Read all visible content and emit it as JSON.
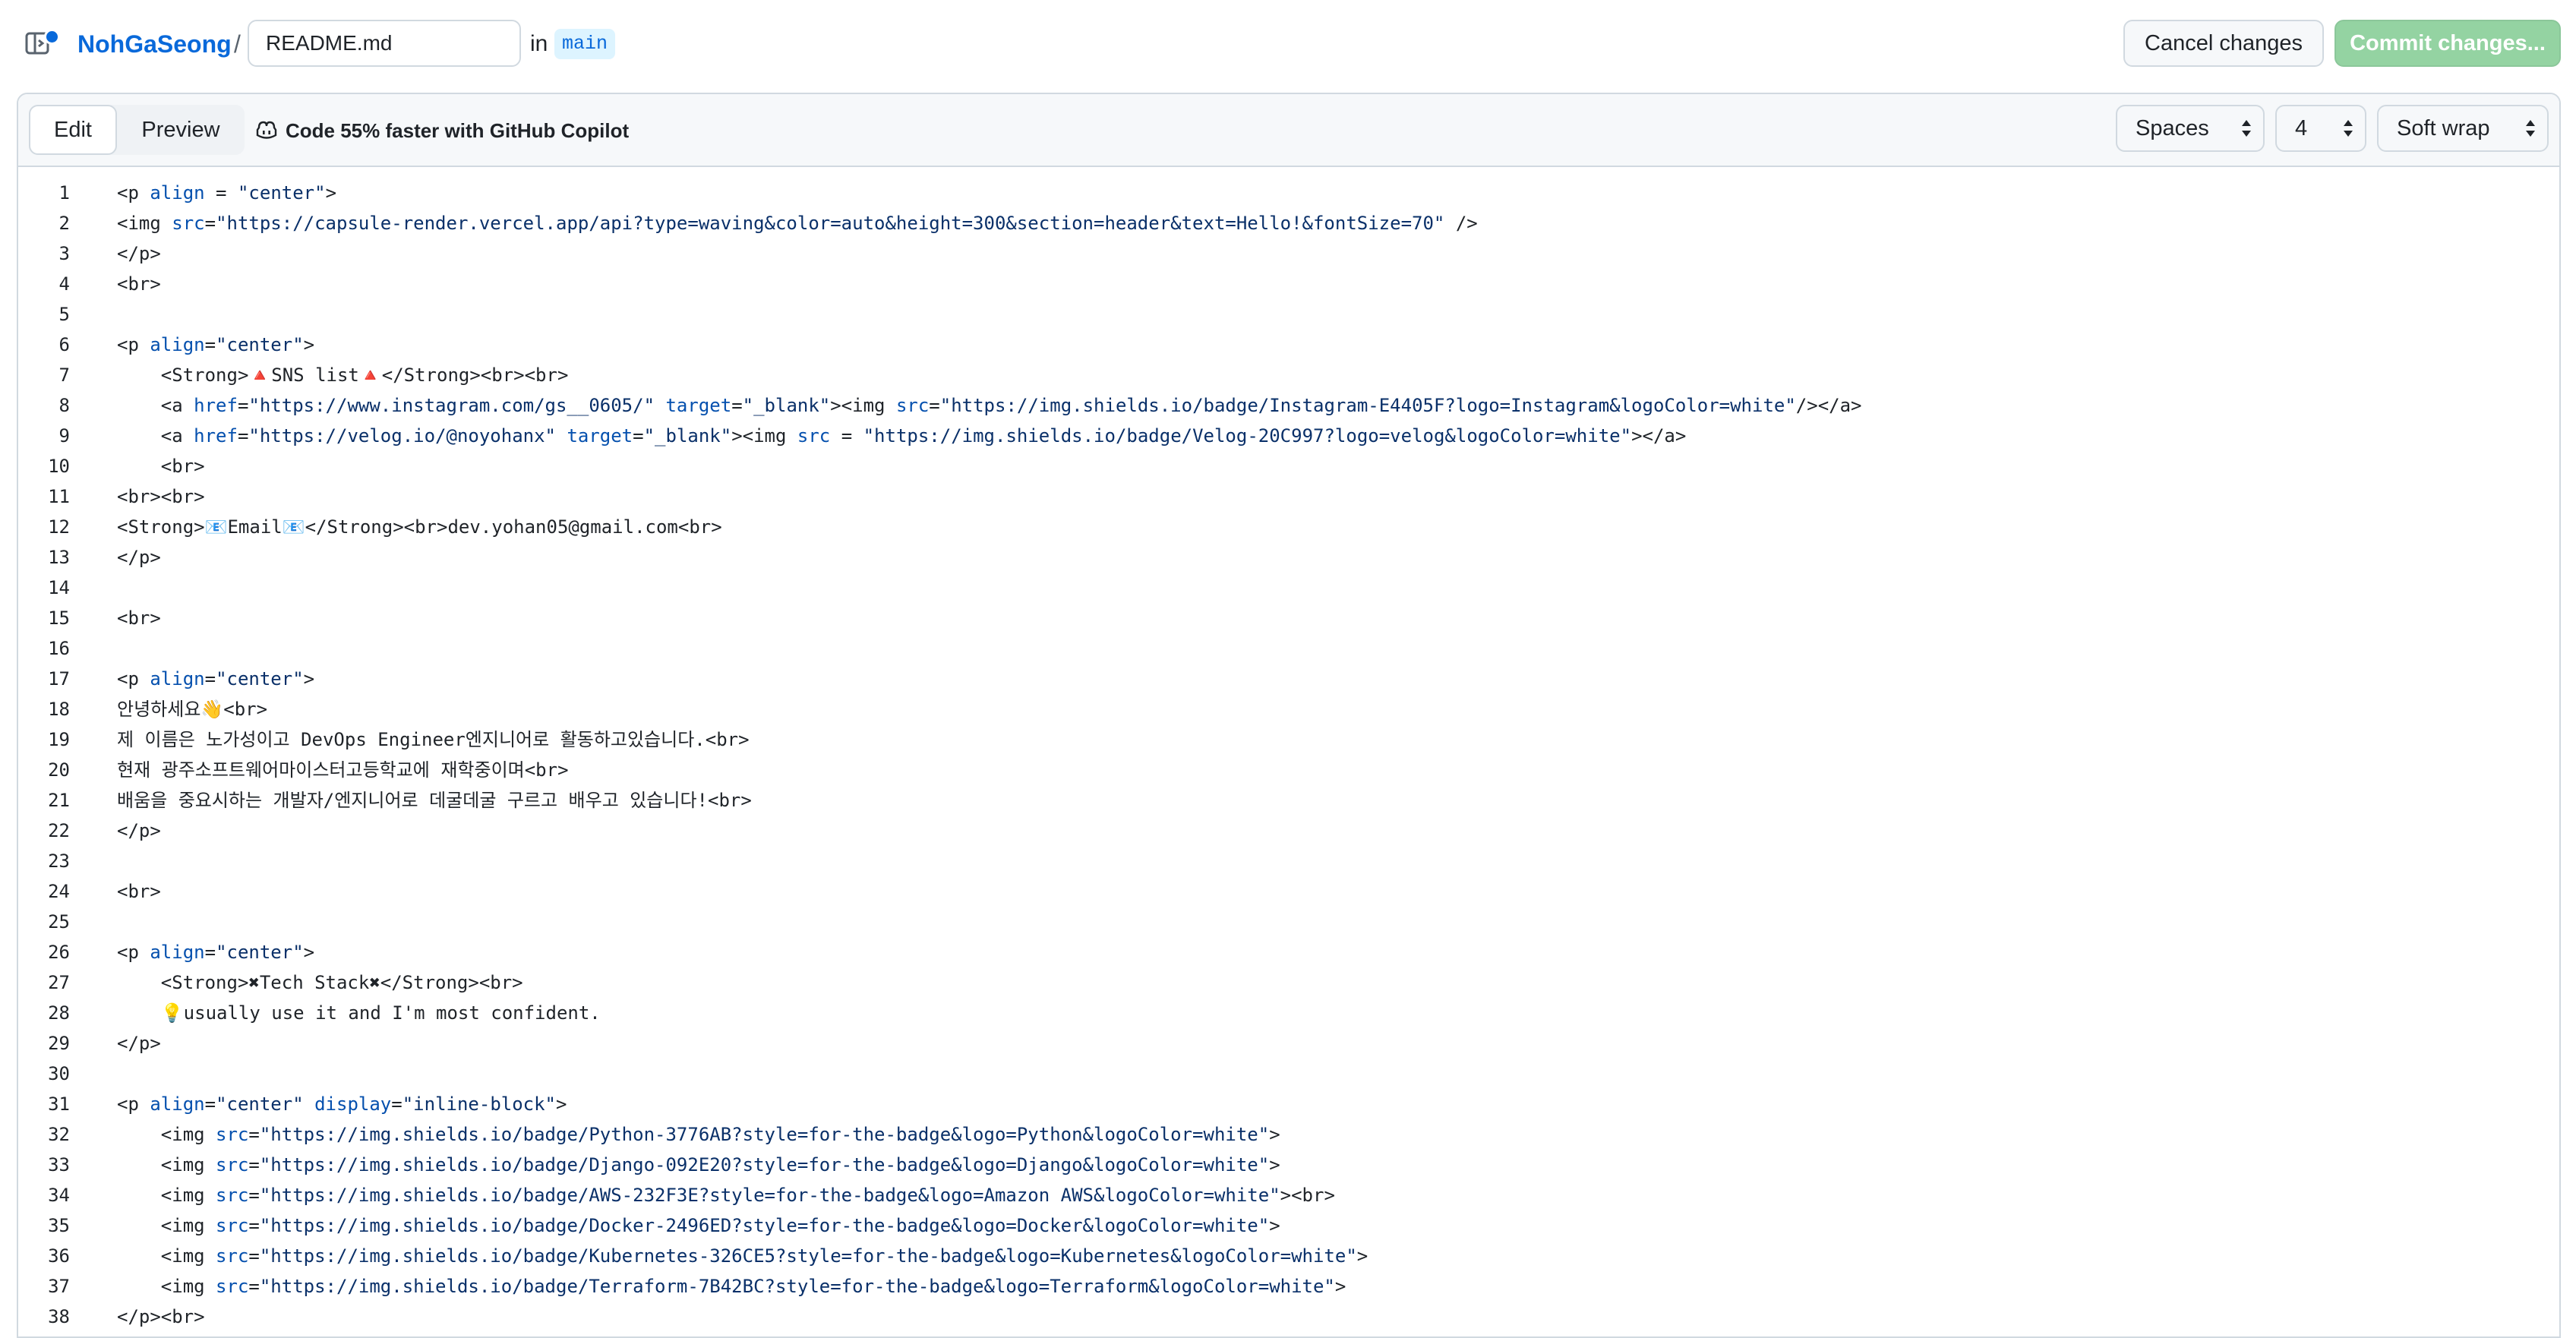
{
  "header": {
    "repo_owner": "NohGaSeong",
    "separator": "/",
    "filename": "README.md",
    "in_label": "in",
    "branch": "main",
    "cancel_label": "Cancel changes",
    "commit_label": "Commit changes..."
  },
  "toolbar": {
    "tab_edit": "Edit",
    "tab_preview": "Preview",
    "copilot_text": "Code 55% faster with GitHub Copilot",
    "indent_mode": "Spaces",
    "indent_size": "4",
    "wrap_mode": "Soft wrap"
  },
  "colors": {
    "link": "#0969da",
    "commit_disabled": "#94d3a2",
    "attr": "#0550ae",
    "string": "#0a3069"
  },
  "code_lines": [
    "<p align = \"center\">",
    "<img src=\"https://capsule-render.vercel.app/api?type=waving&color=auto&height=300&section=header&text=Hello!&fontSize=70\" />",
    "</p>",
    "<br>",
    "",
    "<p align=\"center\">",
    "    <Strong>🔺SNS list🔺</Strong><br><br>",
    "    <a href=\"https://www.instagram.com/gs__0605/\" target=\"_blank\"><img src=\"https://img.shields.io/badge/Instagram-E4405F?logo=Instagram&logoColor=white\"/></a>",
    "    <a href=\"https://velog.io/@noyohanx\" target=\"_blank\"><img src = \"https://img.shields.io/badge/Velog-20C997?logo=velog&logoColor=white\"></a>",
    "    <br>",
    "<br><br>",
    "<Strong>📧Email📧</Strong><br>dev.yohan05@gmail.com<br>",
    "</p>",
    "",
    "<br>",
    "",
    "<p align=\"center\">",
    "안녕하세요👋<br>",
    "제 이름은 노가성이고 DevOps Engineer엔지니어로 활동하고있습니다.<br>",
    "현재 광주소프트웨어마이스터고등학교에 재학중이며<br>",
    "배움을 중요시하는 개발자/엔지니어로 데굴데굴 구르고 배우고 있습니다!<br>",
    "</p>",
    "",
    "<br>",
    "",
    "<p align=\"center\">",
    "    <Strong>✖Tech Stack✖</Strong><br>",
    "    💡usually use it and I'm most confident.",
    "</p>",
    "",
    "<p align=\"center\" display=\"inline-block\">",
    "    <img src=\"https://img.shields.io/badge/Python-3776AB?style=for-the-badge&logo=Python&logoColor=white\">",
    "    <img src=\"https://img.shields.io/badge/Django-092E20?style=for-the-badge&logo=Django&logoColor=white\">",
    "    <img src=\"https://img.shields.io/badge/AWS-232F3E?style=for-the-badge&logo=Amazon AWS&logoColor=white\"><br>",
    "    <img src=\"https://img.shields.io/badge/Docker-2496ED?style=for-the-badge&logo=Docker&logoColor=white\">",
    "    <img src=\"https://img.shields.io/badge/Kubernetes-326CE5?style=for-the-badge&logo=Kubernetes&logoColor=white\">",
    "    <img src=\"https://img.shields.io/badge/Terraform-7B42BC?style=for-the-badge&logo=Terraform&logoColor=white\">",
    "</p><br>"
  ]
}
